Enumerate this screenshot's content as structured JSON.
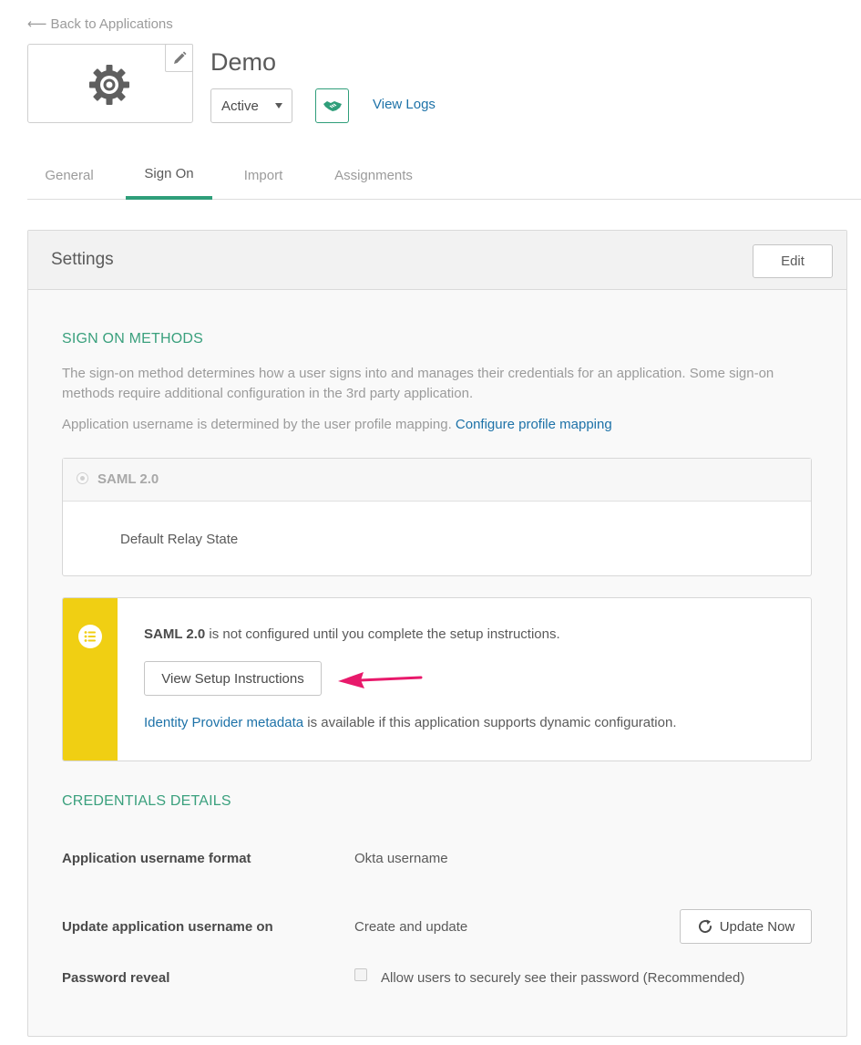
{
  "nav": {
    "back_arrow": "⟵",
    "back_label": "Back to Applications"
  },
  "app": {
    "title": "Demo",
    "logo_icon": "gear-icon",
    "status": "Active",
    "view_logs": "View Logs"
  },
  "tabs": [
    {
      "label": "General",
      "active": false
    },
    {
      "label": "Sign On",
      "active": true
    },
    {
      "label": "Import",
      "active": false
    },
    {
      "label": "Assignments",
      "active": false
    }
  ],
  "settings": {
    "title": "Settings",
    "edit_label": "Edit",
    "sign_on_heading": "SIGN ON METHODS",
    "sign_on_desc": "The sign-on method determines how a user signs into and manages their credentials for an application. Some sign-on methods require additional configuration in the 3rd party application.",
    "username_desc": "Application username is determined by the user profile mapping.",
    "configure_link": "Configure profile mapping",
    "method_label": "SAML 2.0",
    "relay_state_label": "Default Relay State"
  },
  "notice": {
    "method_bold": "SAML 2.0",
    "message": " is not configured until you complete the setup instructions.",
    "setup_button": "View Setup Instructions",
    "metadata_link": "Identity Provider metadata",
    "metadata_text": " is available if this application supports dynamic configuration."
  },
  "credentials": {
    "heading": "CREDENTIALS DETAILS",
    "format_label": "Application username format",
    "format_value": "Okta username",
    "update_label": "Update application username on",
    "update_value": "Create and update",
    "update_button": "Update Now",
    "reveal_label": "Password reveal",
    "reveal_checkbox_label": "Allow users to securely see their password (Recommended)",
    "reveal_checked": false
  },
  "colors": {
    "accent": "#2f9e7a",
    "link": "#1d72a8",
    "notice": "#f0cf13",
    "annotation_arrow": "#e8196b"
  }
}
